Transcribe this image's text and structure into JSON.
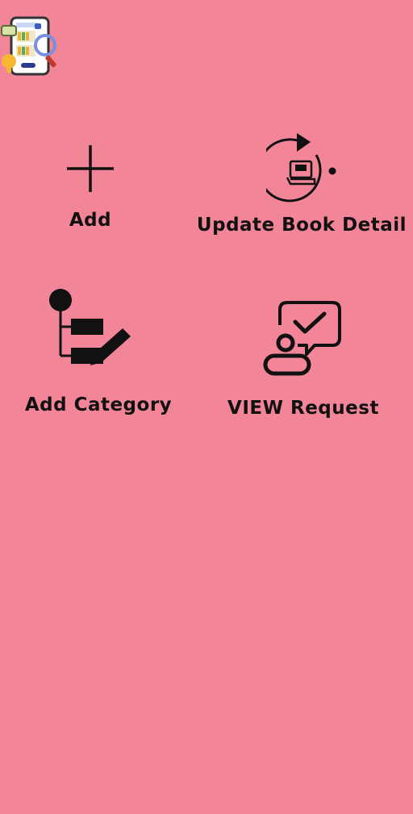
{
  "app": {
    "logo_icon": "library-app-logo-icon"
  },
  "menu": {
    "add": {
      "label": "Add",
      "icon": "plus-icon"
    },
    "update_book": {
      "label": "Update Book Detail",
      "icon": "book-refresh-icon"
    },
    "add_category": {
      "label": "Add Category",
      "icon": "category-edit-icon"
    },
    "view_request": {
      "label": "VIEW Request",
      "icon": "request-approval-icon"
    }
  },
  "colors": {
    "background": "#f38599",
    "foreground": "#111111"
  }
}
